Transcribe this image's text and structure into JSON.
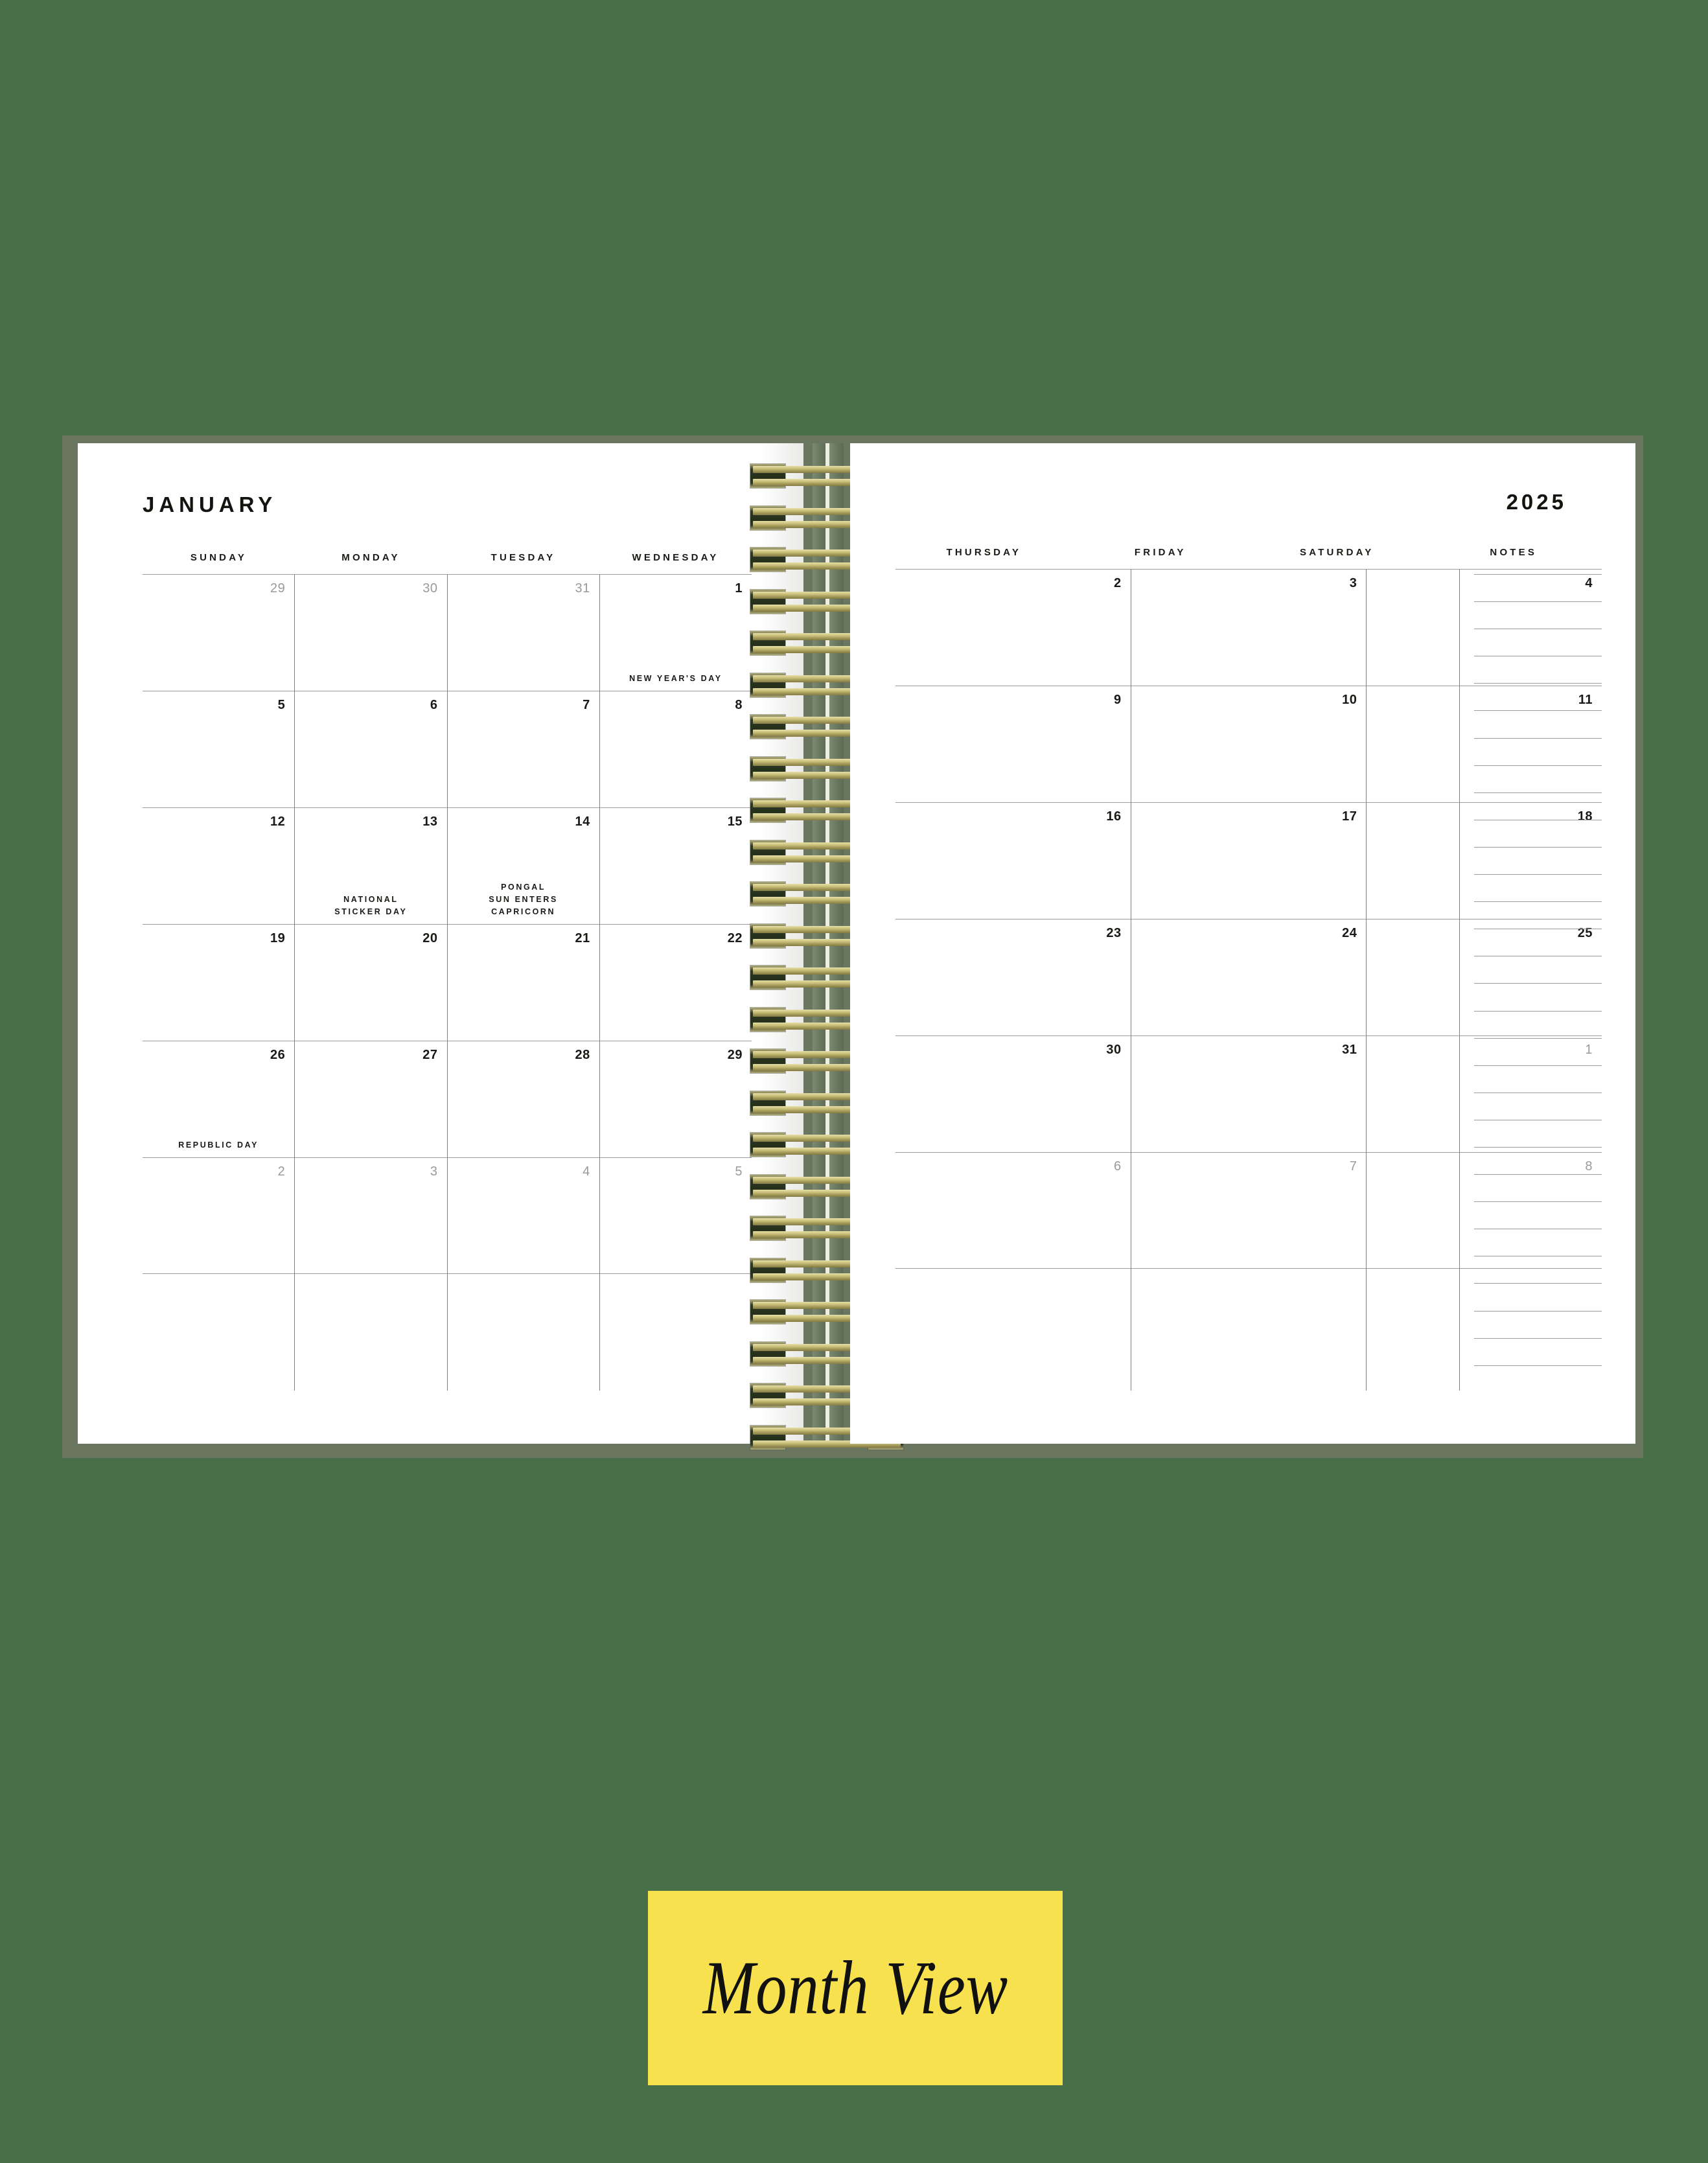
{
  "caption": {
    "label": "Month View"
  },
  "colors": {
    "background_green": "#477049",
    "cover_green": "#6B7660",
    "page_white": "#FFFFFF",
    "caption_yellow": "#F7E14E",
    "spiral_gold": "#C9BF79",
    "ink": "#1B1915",
    "muted_ink": "#9A9A9A",
    "rule": "#9B9B9B"
  },
  "spread": {
    "month": "JANUARY",
    "year": "2025",
    "notes_label": "NOTES",
    "notes_line_count": 30,
    "spiral_coil_count": 24,
    "left_page": {
      "day_headers": [
        "SUNDAY",
        "MONDAY",
        "TUESDAY",
        "WEDNESDAY"
      ],
      "weeks": [
        [
          {
            "day": "29",
            "in_month": false,
            "events": []
          },
          {
            "day": "30",
            "in_month": false,
            "events": []
          },
          {
            "day": "31",
            "in_month": false,
            "events": []
          },
          {
            "day": "1",
            "in_month": true,
            "events": [
              "NEW YEAR'S DAY"
            ]
          }
        ],
        [
          {
            "day": "5",
            "in_month": true,
            "events": []
          },
          {
            "day": "6",
            "in_month": true,
            "events": []
          },
          {
            "day": "7",
            "in_month": true,
            "events": []
          },
          {
            "day": "8",
            "in_month": true,
            "events": []
          }
        ],
        [
          {
            "day": "12",
            "in_month": true,
            "events": []
          },
          {
            "day": "13",
            "in_month": true,
            "events": [
              "NATIONAL",
              "STICKER DAY"
            ]
          },
          {
            "day": "14",
            "in_month": true,
            "events": [
              "PONGAL",
              "SUN ENTERS",
              "CAPRICORN"
            ]
          },
          {
            "day": "15",
            "in_month": true,
            "events": []
          }
        ],
        [
          {
            "day": "19",
            "in_month": true,
            "events": []
          },
          {
            "day": "20",
            "in_month": true,
            "events": []
          },
          {
            "day": "21",
            "in_month": true,
            "events": []
          },
          {
            "day": "22",
            "in_month": true,
            "events": []
          }
        ],
        [
          {
            "day": "26",
            "in_month": true,
            "events": [
              "REPUBLIC DAY"
            ]
          },
          {
            "day": "27",
            "in_month": true,
            "events": []
          },
          {
            "day": "28",
            "in_month": true,
            "events": []
          },
          {
            "day": "29",
            "in_month": true,
            "events": []
          }
        ],
        [
          {
            "day": "2",
            "in_month": false,
            "events": []
          },
          {
            "day": "3",
            "in_month": false,
            "events": []
          },
          {
            "day": "4",
            "in_month": false,
            "events": []
          },
          {
            "day": "5",
            "in_month": false,
            "events": []
          }
        ]
      ]
    },
    "right_page": {
      "day_headers": [
        "THURSDAY",
        "FRIDAY",
        "SATURDAY"
      ],
      "weeks": [
        [
          {
            "day": "2",
            "in_month": true,
            "events": []
          },
          {
            "day": "3",
            "in_month": true,
            "events": []
          },
          {
            "day": "4",
            "in_month": true,
            "events": []
          }
        ],
        [
          {
            "day": "9",
            "in_month": true,
            "events": []
          },
          {
            "day": "10",
            "in_month": true,
            "events": []
          },
          {
            "day": "11",
            "in_month": true,
            "events": []
          }
        ],
        [
          {
            "day": "16",
            "in_month": true,
            "events": []
          },
          {
            "day": "17",
            "in_month": true,
            "events": []
          },
          {
            "day": "18",
            "in_month": true,
            "events": []
          }
        ],
        [
          {
            "day": "23",
            "in_month": true,
            "events": []
          },
          {
            "day": "24",
            "in_month": true,
            "events": []
          },
          {
            "day": "25",
            "in_month": true,
            "events": []
          }
        ],
        [
          {
            "day": "30",
            "in_month": true,
            "events": []
          },
          {
            "day": "31",
            "in_month": true,
            "events": []
          },
          {
            "day": "1",
            "in_month": false,
            "events": []
          }
        ],
        [
          {
            "day": "6",
            "in_month": false,
            "events": []
          },
          {
            "day": "7",
            "in_month": false,
            "events": []
          },
          {
            "day": "8",
            "in_month": false,
            "events": []
          }
        ]
      ]
    }
  }
}
